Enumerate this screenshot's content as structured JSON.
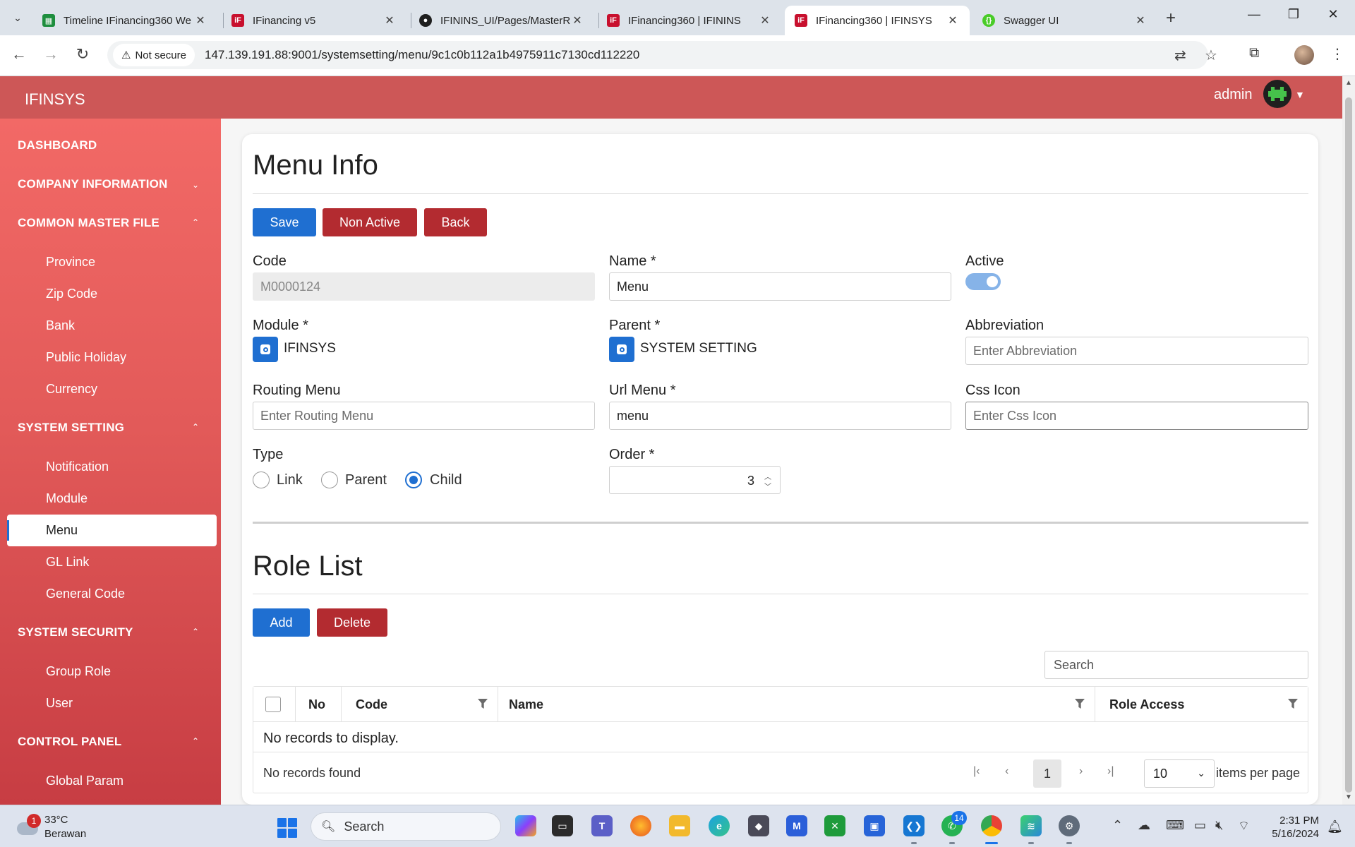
{
  "browser": {
    "tabs": [
      {
        "title": "Timeline IFinancing360 We",
        "icon": "sheets-icon",
        "color": "#1e8e3e"
      },
      {
        "title": "IFinancing v5",
        "icon": "app-icon",
        "color": "#c8102e"
      },
      {
        "title": "IFININS_UI/Pages/MasterR",
        "icon": "github-icon",
        "color": "#1f1f1f"
      },
      {
        "title": "IFinancing360 | IFININS",
        "icon": "app-icon",
        "color": "#c8102e"
      },
      {
        "title": "IFinancing360 | IFINSYS",
        "icon": "app-icon",
        "color": "#c8102e",
        "active": true
      },
      {
        "title": "Swagger UI",
        "icon": "swagger-icon",
        "color": "#49cc28"
      }
    ],
    "security": "Not secure",
    "url": "147.139.191.88:9001/systemsetting/menu/9c1c0b112a1b4975911c7130cd112220"
  },
  "header": {
    "brand": "IFINSYS",
    "user": "admin"
  },
  "sidebar": {
    "dashboard": "DASHBOARD",
    "company_information": "COMPANY INFORMATION",
    "common_master_file": "COMMON MASTER FILE",
    "common_items": [
      "Province",
      "Zip Code",
      "Bank",
      "Public Holiday",
      "Currency"
    ],
    "system_setting": "SYSTEM SETTING",
    "system_items": [
      "Notification",
      "Module",
      "Menu",
      "GL Link",
      "General Code"
    ],
    "system_security": "SYSTEM SECURITY",
    "security_items": [
      "Group Role",
      "User"
    ],
    "control_panel": "CONTROL PANEL",
    "control_items": [
      "Global Param"
    ],
    "active_item": "Menu"
  },
  "menu_info": {
    "title": "Menu Info",
    "buttons": {
      "save": "Save",
      "non_active": "Non Active",
      "back": "Back"
    },
    "code": {
      "label": "Code",
      "value": "M0000124"
    },
    "name": {
      "label": "Name *",
      "value": "Menu"
    },
    "active": {
      "label": "Active",
      "on": true
    },
    "module": {
      "label": "Module *",
      "value": "IFINSYS"
    },
    "parent": {
      "label": "Parent *",
      "value": "SYSTEM SETTING"
    },
    "abbreviation": {
      "label": "Abbreviation",
      "placeholder": "Enter Abbreviation"
    },
    "routing_menu": {
      "label": "Routing Menu",
      "placeholder": "Enter Routing Menu"
    },
    "url_menu": {
      "label": "Url Menu *",
      "value": "menu"
    },
    "css_icon": {
      "label": "Css Icon",
      "placeholder": "Enter Css Icon"
    },
    "type": {
      "label": "Type",
      "options": [
        "Link",
        "Parent",
        "Child"
      ],
      "selected": "Child"
    },
    "order": {
      "label": "Order *",
      "value": "3"
    }
  },
  "role_list": {
    "title": "Role List",
    "buttons": {
      "add": "Add",
      "delete": "Delete"
    },
    "search_placeholder": "Search",
    "columns": [
      "No",
      "Code",
      "Name",
      "Role Access"
    ],
    "empty_text": "No records to display.",
    "footer_text": "No records found",
    "current_page": "1",
    "page_size": "10",
    "per_page_label": "items per page"
  },
  "taskbar": {
    "temperature": "33°C",
    "weather": "Berawan",
    "weather_badge": "1",
    "search": "Search",
    "whatsapp_badge": "14",
    "time": "2:31 PM",
    "date": "5/16/2024"
  }
}
